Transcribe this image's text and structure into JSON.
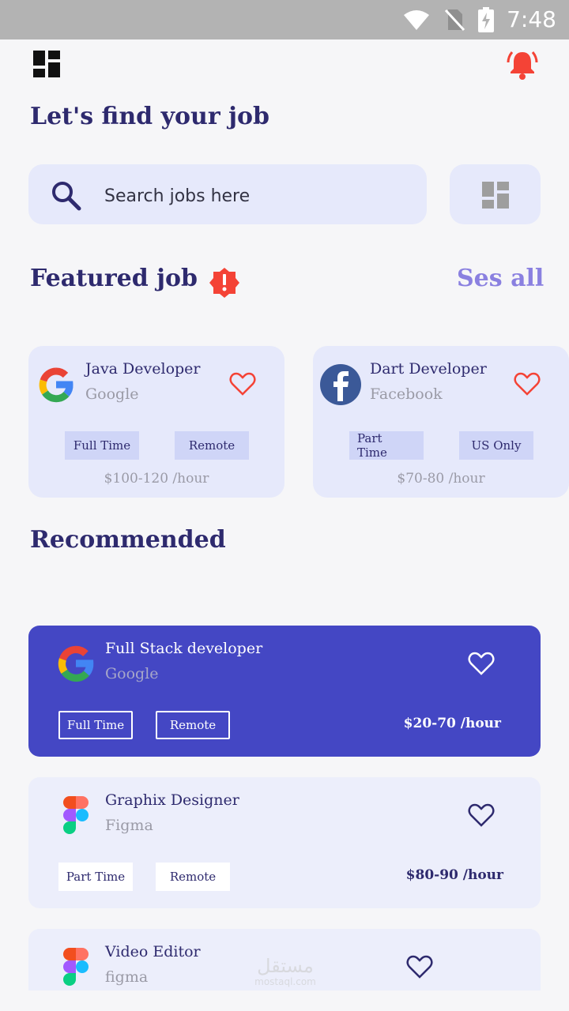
{
  "status_bar": {
    "time": "7:48",
    "icons": [
      "wifi-icon",
      "no-sim-icon",
      "battery-charging-icon"
    ]
  },
  "header": {
    "menu_icon": "dashboard-icon",
    "notification_icon": "bell-ring-icon",
    "title": "Let's find your job"
  },
  "search": {
    "placeholder": "Search jobs here",
    "value": "",
    "filter_icon": "dashboard-icon"
  },
  "featured": {
    "title": "Featured job",
    "alert_icon": "alert-badge-icon",
    "see_all_label": "Ses all",
    "jobs": [
      {
        "title": "Java Developer",
        "company": "Google",
        "logo": "google-logo",
        "tags": [
          "Full Time",
          "Remote"
        ],
        "rate": "$100-120 /hour"
      },
      {
        "title": "Dart Developer",
        "company": "Facebook",
        "logo": "facebook-logo",
        "tags": [
          "Part Time",
          "US Only"
        ],
        "rate": "$70-80 /hour"
      }
    ]
  },
  "recommended": {
    "title": "Recommended",
    "jobs": [
      {
        "title": "Full Stack developer",
        "company": "Google",
        "logo": "google-logo",
        "tags": [
          "Full Time",
          "Remote"
        ],
        "rate": "$20-70 /hour",
        "highlighted": true
      },
      {
        "title": "Graphix Designer",
        "company": "Figma",
        "logo": "figma-logo",
        "tags": [
          "Part Time",
          "Remote"
        ],
        "rate": "$80-90 /hour",
        "highlighted": false
      },
      {
        "title": "Video Editor",
        "company": "figma",
        "logo": "figma-logo",
        "tags": [],
        "rate": "",
        "highlighted": false
      }
    ]
  },
  "watermark": {
    "arabic": "مستقل",
    "latin": "mostaql.com"
  },
  "colors": {
    "primary": "#4447c4",
    "title": "#2e2a6e",
    "accent": "#8a80e0",
    "card": "#e6e9fb",
    "alert": "#f44336"
  }
}
